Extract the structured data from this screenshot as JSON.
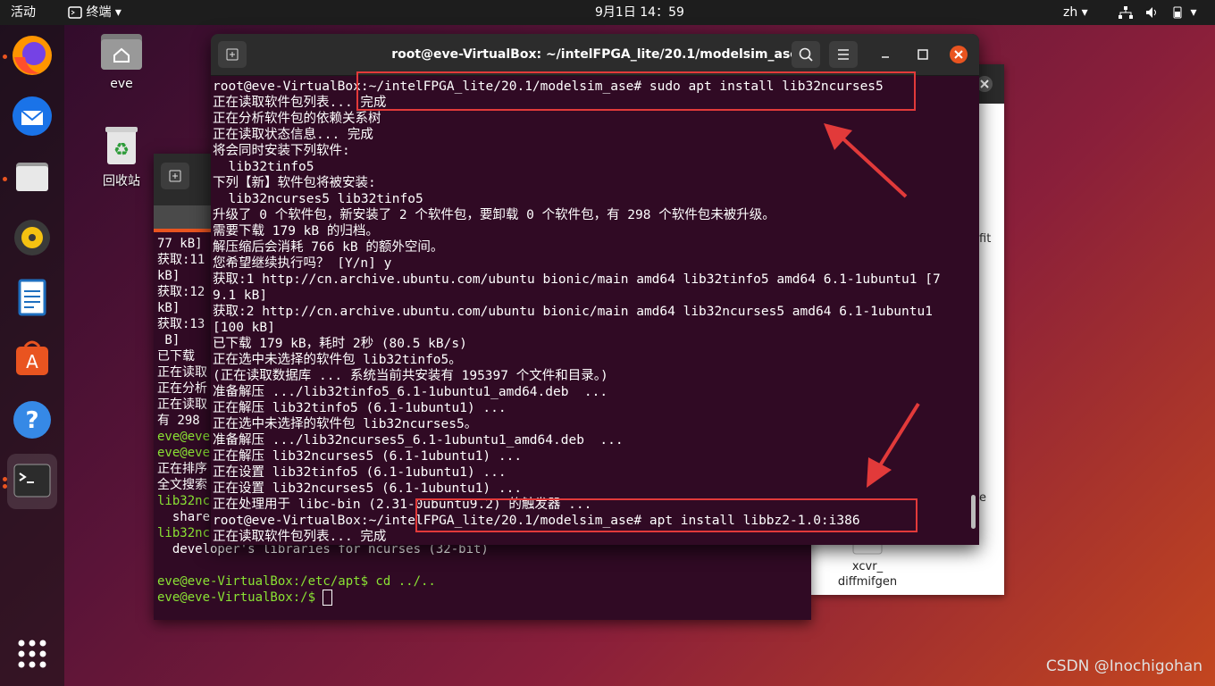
{
  "topbar": {
    "activities": "活动",
    "app_menu": "终端",
    "clock": "9月1日  14：59",
    "lang": "zh"
  },
  "desktop": {
    "home_label": "eve",
    "trash_label": "回收站"
  },
  "file_manager": {
    "item_label": "xcvr_\ndiffmifgen",
    "side_text_1": "fit",
    "side_text_2": "e"
  },
  "terminal": {
    "title": "root@eve-VirtualBox: ~/intelFPGA_lite/20.1/modelsim_ase",
    "lines": [
      "root@eve-VirtualBox:~/intelFPGA_lite/20.1/modelsim_ase# sudo apt install lib32ncurses5",
      "正在读取软件包列表... 完成",
      "正在分析软件包的依赖关系树",
      "正在读取状态信息... 完成",
      "将会同时安装下列软件:",
      "  lib32tinfo5",
      "下列【新】软件包将被安装:",
      "  lib32ncurses5 lib32tinfo5",
      "升级了 0 个软件包，新安装了 2 个软件包，要卸载 0 个软件包，有 298 个软件包未被升级。",
      "需要下载 179 kB 的归档。",
      "解压缩后会消耗 766 kB 的额外空间。",
      "您希望继续执行吗？ [Y/n] y",
      "获取:1 http://cn.archive.ubuntu.com/ubuntu bionic/main amd64 lib32tinfo5 amd64 6.1-1ubuntu1 [7",
      "9.1 kB]",
      "获取:2 http://cn.archive.ubuntu.com/ubuntu bionic/main amd64 lib32ncurses5 amd64 6.1-1ubuntu1",
      "[100 kB]",
      "已下载 179 kB，耗时 2秒 (80.5 kB/s)",
      "正在选中未选择的软件包 lib32tinfo5。",
      "(正在读取数据库 ... 系统当前共安装有 195397 个文件和目录。)",
      "准备解压 .../lib32tinfo5_6.1-1ubuntu1_amd64.deb  ...",
      "正在解压 lib32tinfo5 (6.1-1ubuntu1) ...",
      "正在选中未选择的软件包 lib32ncurses5。",
      "准备解压 .../lib32ncurses5_6.1-1ubuntu1_amd64.deb  ...",
      "正在解压 lib32ncurses5 (6.1-1ubuntu1) ...",
      "正在设置 lib32tinfo5 (6.1-1ubuntu1) ...",
      "正在设置 lib32ncurses5 (6.1-1ubuntu1) ...",
      "正在处理用于 libc-bin (2.31-0ubuntu9.2) 的触发器 ...",
      "root@eve-VirtualBox:~/intelFPGA_lite/20.1/modelsim_ase# apt install libbz2-1.0:i386",
      "正在读取软件包列表... 完成"
    ]
  },
  "back_terminal": {
    "lines": [
      "77 kB]",
      "获取:11",
      "kB]",
      "获取:12",
      "kB]",
      "获取:13",
      " B]",
      "已下载",
      "正在读取",
      "正在分析",
      "正在读取",
      "有 298",
      "eve@eve",
      "eve@eve",
      "正在排序",
      "全文搜索",
      "lib32nc",
      "  share",
      "lib32ncurses5-dev/bionic 6.1-1ubuntu1 amd64",
      "  developer's libraries for ncurses (32-bit)",
      "",
      "eve@eve-VirtualBox:/etc/apt$ cd ../..",
      "eve@eve-VirtualBox:/$ "
    ],
    "prompt_user": "eve@eve-VirtualBox",
    "prompt_path_1": "/etc/apt",
    "prompt_cmd_1": "$ cd ../..",
    "prompt_path_2": "/",
    "prompt_cmd_2": "$ "
  },
  "watermark": "CSDN @Inochigohan",
  "colors": {
    "accent": "#e95420",
    "terminal_bg": "#300a24",
    "highlight": "#e23a3a",
    "prompt_green": "#8ae234",
    "prompt_blue": "#729fcf"
  }
}
